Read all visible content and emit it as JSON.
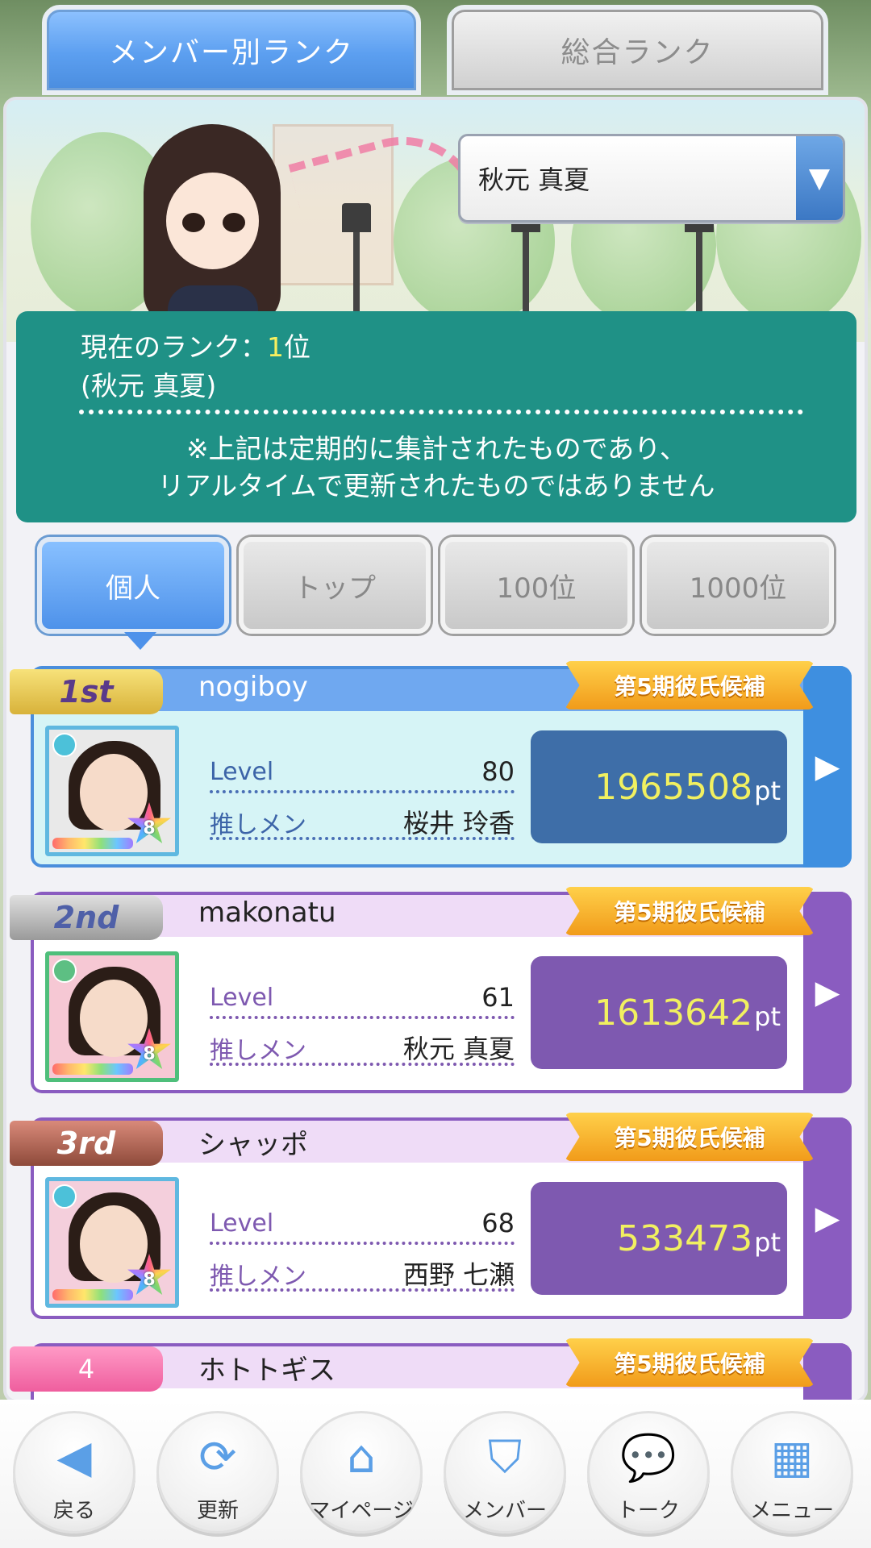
{
  "tabs": {
    "member_rank": "メンバー別ランク",
    "overall_rank": "総合ランク"
  },
  "member_select": {
    "value": "秋元 真夏",
    "arrow": "▼"
  },
  "rank_info": {
    "label": "現在のランク：",
    "rank": "1",
    "suffix": "位",
    "name": "(秋元 真夏)",
    "note_line1": "※上記は定期的に集計されたものであり、",
    "note_line2": "リアルタイムで更新されたものではありません"
  },
  "sub_tabs": [
    "個人",
    "トップ",
    "100位",
    "1000位"
  ],
  "ranking": [
    {
      "rank_label": "1st",
      "username": "nogiboy",
      "badge": "第5期彼氏候補",
      "level_label": "Level",
      "level": "80",
      "oshi_label": "推しメン",
      "oshi": "桜井 玲香",
      "points": "1965508",
      "pt": "pt",
      "star_level": "8"
    },
    {
      "rank_label": "2nd",
      "username": "makonatu",
      "badge": "第5期彼氏候補",
      "level_label": "Level",
      "level": "61",
      "oshi_label": "推しメン",
      "oshi": "秋元 真夏",
      "points": "1613642",
      "pt": "pt",
      "star_level": "8"
    },
    {
      "rank_label": "3rd",
      "username": "シャッポ",
      "badge": "第5期彼氏候補",
      "level_label": "Level",
      "level": "68",
      "oshi_label": "推しメン",
      "oshi": "西野 七瀬",
      "points": "533473",
      "pt": "pt",
      "star_level": "8"
    },
    {
      "rank_label": "4",
      "username": "ホトトギス",
      "badge": "第5期彼氏候補"
    }
  ],
  "bottom_nav": [
    {
      "label": "戻る",
      "icon": "back-icon"
    },
    {
      "label": "更新",
      "icon": "refresh-icon"
    },
    {
      "label": "マイページ",
      "icon": "home-icon"
    },
    {
      "label": "メンバー",
      "icon": "shield-icon"
    },
    {
      "label": "トーク",
      "icon": "chat-icon"
    },
    {
      "label": "メニュー",
      "icon": "grid-icon"
    }
  ],
  "colors": {
    "accent_blue": "#4e92ea",
    "teal": "#1f9186",
    "purple": "#7e59b0",
    "points_yellow": "#f1f060"
  }
}
